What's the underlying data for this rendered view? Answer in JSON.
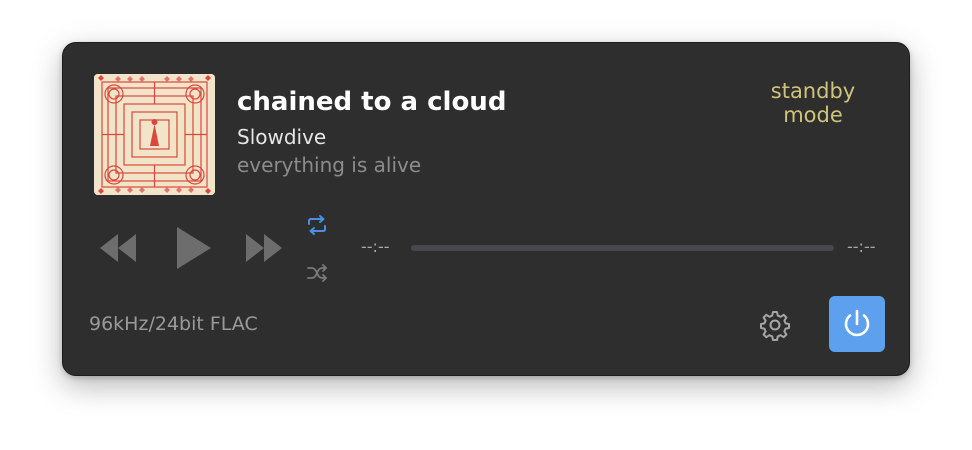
{
  "track": {
    "title": "chained to a cloud",
    "artist": "Slowdive",
    "album": "everything is alive"
  },
  "status": {
    "standby_text": "standby\nmode",
    "standby_color": "#cfc47c"
  },
  "playback": {
    "elapsed": "--:--",
    "remaining": "--:--",
    "progress_fraction": 0,
    "repeat_enabled": true,
    "shuffle_enabled": false
  },
  "audio": {
    "format": "96kHz/24bit FLAC"
  },
  "icons": {
    "rewind": "rewind-icon",
    "play": "play-icon",
    "fast_forward": "fast-forward-icon",
    "repeat": "repeat-icon",
    "shuffle": "shuffle-icon",
    "settings": "gear-icon",
    "power": "power-icon"
  },
  "colors": {
    "panel": "#2e2e2e",
    "accent": "#5ca0ee",
    "repeat_active": "#4a8fe0",
    "control": "#6d6d6d"
  }
}
